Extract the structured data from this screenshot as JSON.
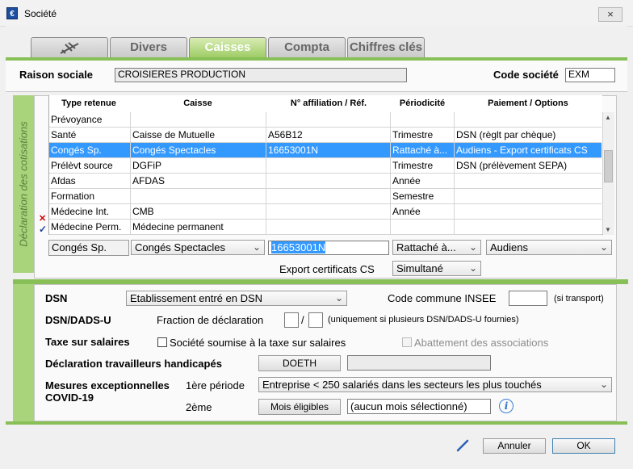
{
  "window": {
    "title": "Société",
    "close_icon": "×"
  },
  "tabs": [
    {
      "label": "",
      "icon": "plane-icon"
    },
    {
      "label": "Divers"
    },
    {
      "label": "Caisses",
      "active": true
    },
    {
      "label": "Compta"
    },
    {
      "label": "Chiffres clés"
    }
  ],
  "header": {
    "raison_label": "Raison sociale",
    "raison_value": "CROISIERES PRODUCTION",
    "code_label": "Code société",
    "code_value": "EXM"
  },
  "cotisations": {
    "section_label": "Déclaration des cotisations",
    "columns": [
      "Type retenue",
      "Caisse",
      "N° affiliation / Réf.",
      "Périodicité",
      "Paiement / Options"
    ],
    "rows": [
      [
        "Prévoyance",
        "",
        "",
        "",
        ""
      ],
      [
        "Santé",
        "Caisse de Mutuelle",
        "A56B12",
        "Trimestre",
        "DSN (règlt par chèque)"
      ],
      [
        "Congés Sp.",
        "Congés Spectacles",
        "16653001N",
        "Rattaché à...",
        "Audiens - Export certificats CS"
      ],
      [
        "Prélèvt source",
        "DGFiP",
        "",
        "Trimestre",
        "DSN (prélèvement SEPA)"
      ],
      [
        "Afdas",
        "AFDAS",
        "",
        "Année",
        ""
      ],
      [
        "Formation",
        "",
        "",
        "Semestre",
        ""
      ],
      [
        "Médecine Int.",
        "CMB",
        "",
        "Année",
        ""
      ],
      [
        "Médecine Perm.",
        "Médecine permanent",
        "",
        "",
        ""
      ]
    ],
    "selected_row": 2,
    "edit": {
      "type": "Congés Sp.",
      "caisse": "Congés Spectacles",
      "affiliation": "16653001N",
      "periodicite": "Rattaché à...",
      "paiement": "Audiens"
    },
    "export_label": "Export certificats CS",
    "export_value": "Simultané"
  },
  "dsn": {
    "label": "DSN",
    "value": "Etablissement entré en DSN",
    "insee_label": "Code commune INSEE",
    "insee_value": "",
    "insee_note": "(si transport)"
  },
  "dads": {
    "label": "DSN/DADS-U",
    "fraction_label": "Fraction de déclaration",
    "fraction_a": "",
    "fraction_sep": "/",
    "fraction_b": "",
    "note": "(uniquement si plusieurs DSN/DADS-U fournies)"
  },
  "taxe": {
    "label": "Taxe sur salaires",
    "checkbox_label": "Société soumise à la taxe sur salaires",
    "abattement_label": "Abattement des associations"
  },
  "handicap": {
    "label": "Déclaration travailleurs handicapés",
    "button": "DOETH",
    "value": ""
  },
  "covid": {
    "label_line1": "Mesures exceptionnelles",
    "label_line2": "COVID-19",
    "periode1_label": "1ère période",
    "periode1_value": "Entreprise < 250 salariés dans les secteurs les plus touchés",
    "periode2_label": "2ème",
    "mois_button": "Mois éligibles",
    "mois_value": "(aucun mois sélectionné)",
    "info_icon": "i"
  },
  "footer": {
    "cancel": "Annuler",
    "ok": "OK"
  },
  "colors": {
    "accent_green": "#88c057",
    "selection_blue": "#3399ff"
  }
}
